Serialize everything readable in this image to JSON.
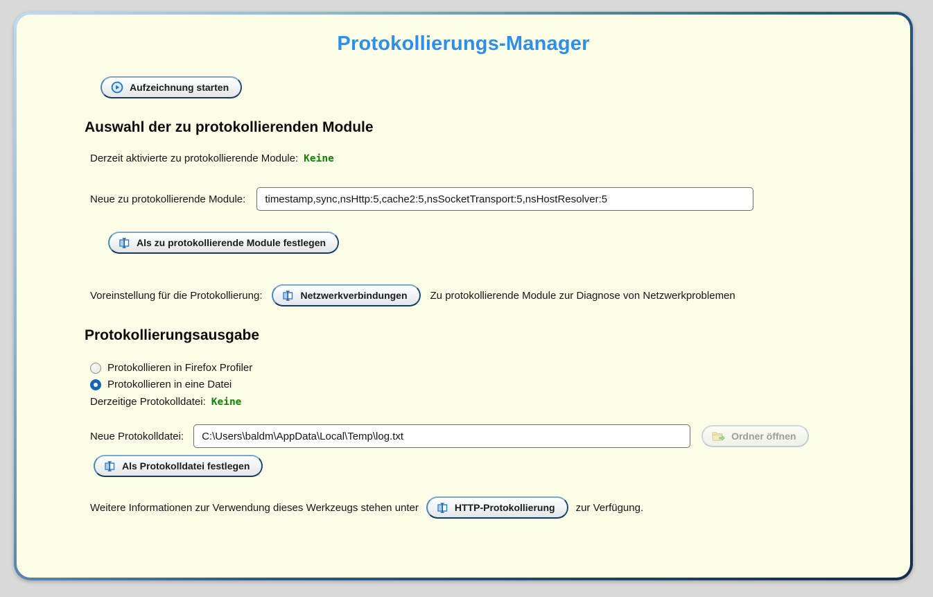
{
  "page": {
    "title": "Protokollierungs-Manager",
    "background_color": "#d9d9d9",
    "card_color": "#fdfde7",
    "accent_blue": "#2d8fe8",
    "value_green": "#0d8500"
  },
  "toolbar": {
    "start_button_label": "Aufzeichnung starten"
  },
  "modules_section": {
    "heading": "Auswahl der zu protokollierenden Module",
    "current_modules_label": "Derzeit aktivierte zu protokollierende Module:",
    "current_modules_value": "Keine",
    "new_modules_label": "Neue zu protokollierende Module:",
    "new_modules_value": "timestamp,sync,nsHttp:5,cache2:5,nsSocketTransport:5,nsHostResolver:5",
    "set_modules_button": "Als zu protokollierende Module festlegen",
    "preset_label": "Voreinstellung für die Protokollierung:",
    "preset_button": "Netzwerkverbindungen",
    "preset_description": "Zu protokollierende Module zur Diagnose von Netzwerkproblemen"
  },
  "output_section": {
    "heading": "Protokollierungsausgabe",
    "radio_profiler_label": "Protokollieren in Firefox Profiler",
    "radio_file_label": "Protokollieren in eine Datei",
    "selected_output": "file",
    "current_file_label": "Derzeitige Protokolldatei:",
    "current_file_value": "Keine",
    "new_file_label": "Neue Protokolldatei:",
    "new_file_value": "C:\\Users\\baldm\\AppData\\Local\\Temp\\log.txt",
    "open_folder_button": "Ordner öffnen",
    "set_file_button": "Als Protokolldatei festlegen"
  },
  "footer": {
    "text_before": "Weitere Informationen zur Verwendung dieses Werkzeugs stehen unter",
    "link_button": "HTTP-Protokollierung",
    "text_after": "zur Verfügung."
  }
}
